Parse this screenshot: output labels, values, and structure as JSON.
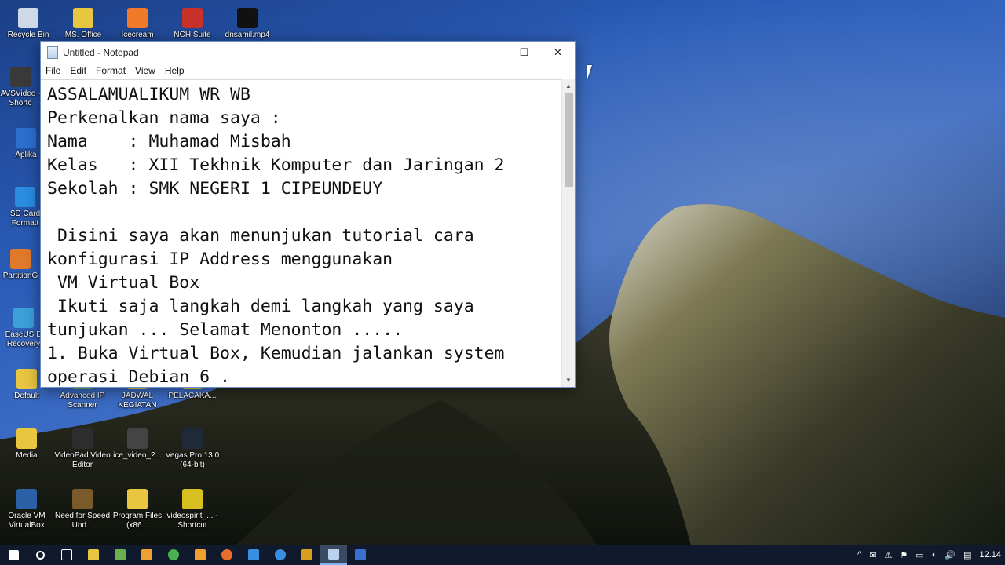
{
  "desktop_icons": [
    {
      "label": "Recycle Bin",
      "color": "#cfd8e6"
    },
    {
      "label": "MS. Office",
      "color": "#e8c640"
    },
    {
      "label": "Icecream",
      "color": "#f07a2a"
    },
    {
      "label": "NCH Suite",
      "color": "#c8302a"
    },
    {
      "label": "dnsamil.mp4",
      "color": "#111111"
    },
    {
      "label": "AVSVideo - Shortc",
      "color": "#3a3a3a"
    },
    {
      "label": "Aplika",
      "color": "#2d6fcf"
    },
    {
      "label": "SD Card Formatt",
      "color": "#2a8de0"
    },
    {
      "label": "PartitionG",
      "color": "#e07a2a"
    },
    {
      "label": "EaseUS D Recovery",
      "color": "#3aa0d8"
    },
    {
      "label": "Default",
      "color": "#e8c640"
    },
    {
      "label": "Advanced IP Scanner",
      "color": "#6ab04c"
    },
    {
      "label": "JADWAL KEGIATAN",
      "color": "#e8c640"
    },
    {
      "label": "PELACAKA...",
      "color": "#e8c640"
    },
    {
      "label": "Media",
      "color": "#e8c640"
    },
    {
      "label": "VideoPad Video Editor",
      "color": "#2d2d2d"
    },
    {
      "label": "ice_video_2...",
      "color": "#444444"
    },
    {
      "label": "Vegas Pro 13.0 (64-bit)",
      "color": "#1e2a3a"
    },
    {
      "label": "Oracle VM VirtualBox",
      "color": "#2b5fa6"
    },
    {
      "label": "Need for Speed Und...",
      "color": "#7a5a2a"
    },
    {
      "label": "Program Files (x86...",
      "color": "#e8c640"
    },
    {
      "label": "videospirit_... - Shortcut",
      "color": "#d8c020"
    }
  ],
  "notepad": {
    "title": "Untitled - Notepad",
    "minimize": "—",
    "maximize": "☐",
    "close": "✕",
    "menu": [
      "File",
      "Edit",
      "Format",
      "View",
      "Help"
    ],
    "content": "ASSALAMUALIKUM WR WB\nPerkenalkan nama saya :\nNama    : Muhamad Misbah\nKelas   : XII Tekhnik Komputer dan Jaringan 2\nSekolah : SMK NEGERI 1 CIPEUNDEUY\n\n Disini saya akan menunjukan tutorial cara\nkonfigurasi IP Address menggunakan\n VM Virtual Box\n Ikuti saja langkah demi langkah yang saya\ntunjukan ... Selamat Menonton .....\n1. Buka Virtual Box, Kemudian jalankan system\noperasi Debian 6 ."
  },
  "taskbar": {
    "items": [
      {
        "name": "start-button",
        "color": "#ffffff"
      },
      {
        "name": "search-icon",
        "color": "#ffffff"
      },
      {
        "name": "task-view-icon",
        "color": "#ffffff"
      },
      {
        "name": "file-explorer-icon",
        "color": "#e8c640"
      },
      {
        "name": "store-icon",
        "color": "#6ab04c"
      },
      {
        "name": "app-icon",
        "color": "#f0a030"
      },
      {
        "name": "chrome-icon",
        "color": "#4caf50"
      },
      {
        "name": "media-player-icon",
        "color": "#f0a030"
      },
      {
        "name": "firefox-icon",
        "color": "#e8702a"
      },
      {
        "name": "network-tool-icon",
        "color": "#3a8ee0"
      },
      {
        "name": "ie-icon",
        "color": "#3a8ee0"
      },
      {
        "name": "videopad-icon",
        "color": "#d8a020"
      },
      {
        "name": "notepad-icon",
        "color": "#b9d2ee"
      },
      {
        "name": "calculator-icon",
        "color": "#3a6fd0"
      }
    ],
    "tray": [
      "^",
      "✉",
      "⚠",
      "⚑",
      "▭",
      "◐",
      "🔊",
      "▤"
    ],
    "clock": "12.14"
  }
}
